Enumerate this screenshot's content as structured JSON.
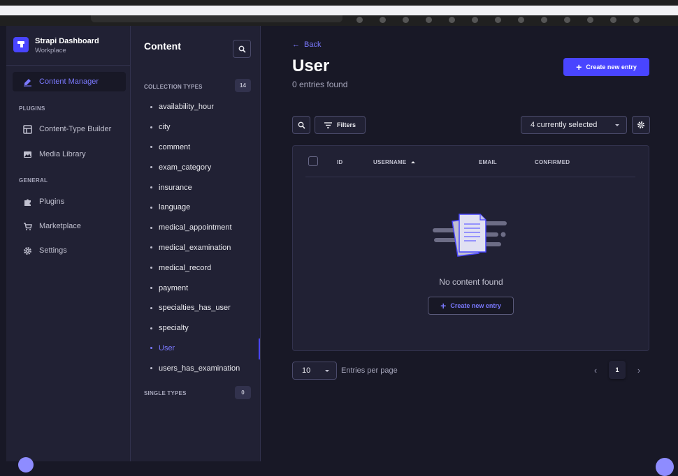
{
  "brand": {
    "title": "Strapi Dashboard",
    "subtitle": "Workplace"
  },
  "mainnav": {
    "content_manager": "Content Manager",
    "plugins_head": "PLUGINS",
    "content_type_builder": "Content-Type Builder",
    "media_library": "Media Library",
    "general_head": "GENERAL",
    "plugins": "Plugins",
    "marketplace": "Marketplace",
    "settings": "Settings"
  },
  "subnav": {
    "title": "Content",
    "collection_head": "COLLECTION TYPES",
    "collection_count": "14",
    "single_head": "SINGLE TYPES",
    "single_count": "0",
    "items": [
      "availability_hour",
      "city",
      "comment",
      "exam_category",
      "insurance",
      "language",
      "medical_appointment",
      "medical_examination",
      "medical_record",
      "payment",
      "specialties_has_user",
      "specialty",
      "User",
      "users_has_examination"
    ],
    "active_item": "User"
  },
  "main": {
    "back": "Back",
    "title": "User",
    "subtitle": "0 entries found",
    "create_label": "Create new entry",
    "filters_label": "Filters",
    "columns_select": "4 currently selected",
    "columns": {
      "id": "ID",
      "username": "USERNAME",
      "email": "EMAIL",
      "confirmed": "CONFIRMED"
    },
    "empty_text": "No content found",
    "empty_create_label": "Create new entry",
    "page_size": "10",
    "page_size_label": "Entries per page",
    "current_page": "1"
  },
  "colors": {
    "primary": "#4945ff",
    "accent": "#7b79ff",
    "bg": "#181826",
    "panel": "#212134"
  }
}
